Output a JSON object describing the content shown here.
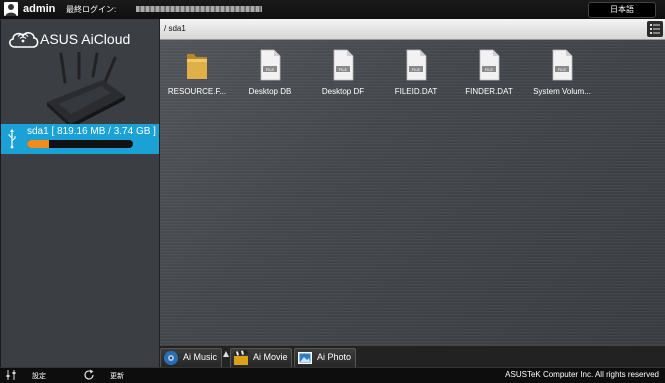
{
  "topbar": {
    "username": "admin",
    "last_login_label": "最終ログイン:",
    "language_button": "日本語"
  },
  "sidebar": {
    "brand": "ASUS AiCloud",
    "drive": {
      "label": "sda1 [ 819.16 MB / 3.74 GB ]",
      "usage_fraction": 0.21
    }
  },
  "pathbar": {
    "path": "/ sda1"
  },
  "files": [
    {
      "name": "RESOURCE.F...",
      "type": "folder"
    },
    {
      "name": "Desktop DB",
      "type": "file"
    },
    {
      "name": "Desktop DF",
      "type": "file"
    },
    {
      "name": "FILEID.DAT",
      "type": "file"
    },
    {
      "name": "FINDER.DAT",
      "type": "file"
    },
    {
      "name": "System Volum...",
      "type": "file"
    }
  ],
  "file_badge": "FILE",
  "apps": {
    "music": "Ai Music",
    "movie": "Ai Movie",
    "photo": "Ai Photo"
  },
  "footer": {
    "settings_label": "設定",
    "refresh_label": "更新",
    "copyright": "ASUSTeK Computer Inc. All rights reserved"
  },
  "colors": {
    "accent": "#1aa1d6",
    "usage_bar": "#f28b1c"
  }
}
